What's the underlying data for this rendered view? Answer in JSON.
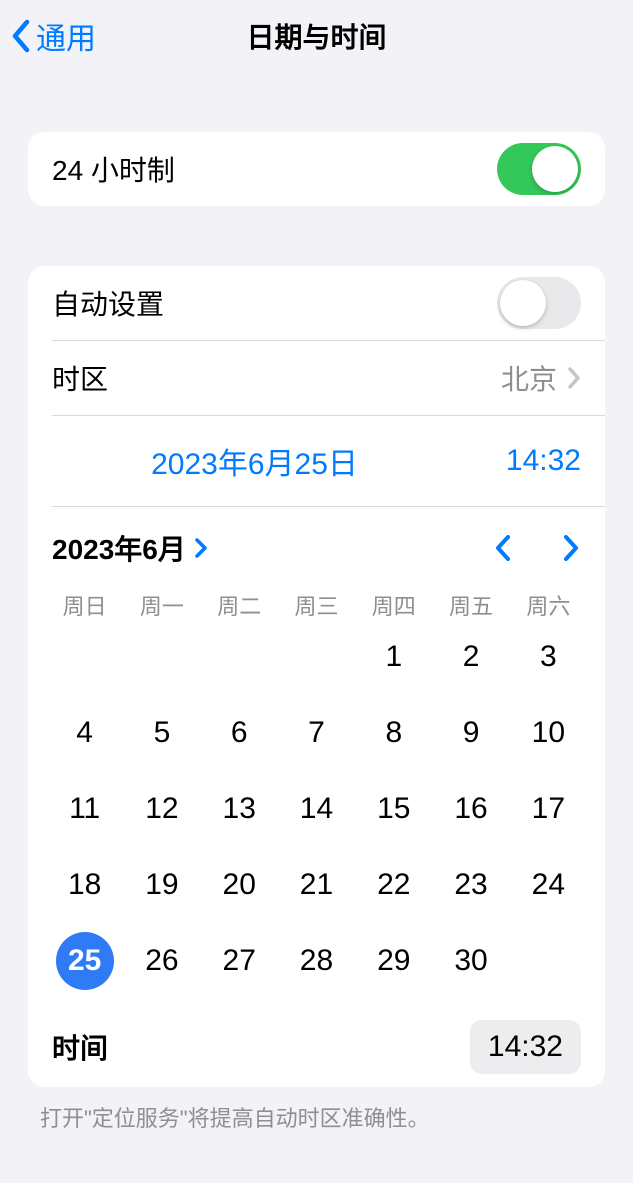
{
  "nav": {
    "back": "通用",
    "title": "日期与时间"
  },
  "rows": {
    "hour24": "24 小时制",
    "autoset": "自动设置",
    "timezone_label": "时区",
    "timezone_value": "北京",
    "date_button": "2023年6月25日",
    "time_button": "14:32",
    "time_row_label": "时间",
    "time_row_value": "14:32"
  },
  "calendar": {
    "month_label": "2023年6月",
    "weekdays": [
      "周日",
      "周一",
      "周二",
      "周三",
      "周四",
      "周五",
      "周六"
    ],
    "leading_blanks": 4,
    "days_in_month": 30,
    "selected_day": 25
  },
  "footer": "打开\"定位服务\"将提高自动时区准确性。"
}
